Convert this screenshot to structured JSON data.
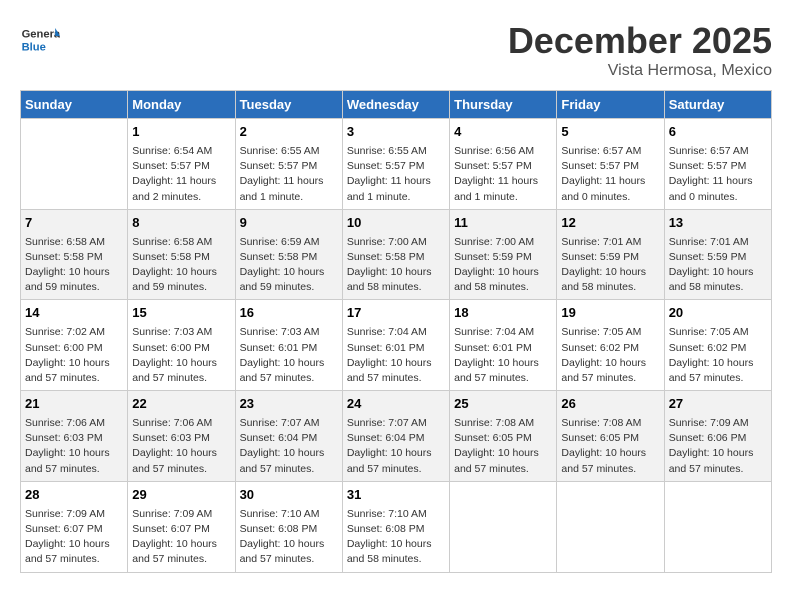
{
  "header": {
    "logo_general": "General",
    "logo_blue": "Blue",
    "title": "December 2025",
    "subtitle": "Vista Hermosa, Mexico"
  },
  "days_of_week": [
    "Sunday",
    "Monday",
    "Tuesday",
    "Wednesday",
    "Thursday",
    "Friday",
    "Saturday"
  ],
  "weeks": [
    [
      {
        "day": "",
        "info": ""
      },
      {
        "day": "1",
        "info": "Sunrise: 6:54 AM\nSunset: 5:57 PM\nDaylight: 11 hours\nand 2 minutes."
      },
      {
        "day": "2",
        "info": "Sunrise: 6:55 AM\nSunset: 5:57 PM\nDaylight: 11 hours\nand 1 minute."
      },
      {
        "day": "3",
        "info": "Sunrise: 6:55 AM\nSunset: 5:57 PM\nDaylight: 11 hours\nand 1 minute."
      },
      {
        "day": "4",
        "info": "Sunrise: 6:56 AM\nSunset: 5:57 PM\nDaylight: 11 hours\nand 1 minute."
      },
      {
        "day": "5",
        "info": "Sunrise: 6:57 AM\nSunset: 5:57 PM\nDaylight: 11 hours\nand 0 minutes."
      },
      {
        "day": "6",
        "info": "Sunrise: 6:57 AM\nSunset: 5:57 PM\nDaylight: 11 hours\nand 0 minutes."
      }
    ],
    [
      {
        "day": "7",
        "info": "Sunrise: 6:58 AM\nSunset: 5:58 PM\nDaylight: 10 hours\nand 59 minutes."
      },
      {
        "day": "8",
        "info": "Sunrise: 6:58 AM\nSunset: 5:58 PM\nDaylight: 10 hours\nand 59 minutes."
      },
      {
        "day": "9",
        "info": "Sunrise: 6:59 AM\nSunset: 5:58 PM\nDaylight: 10 hours\nand 59 minutes."
      },
      {
        "day": "10",
        "info": "Sunrise: 7:00 AM\nSunset: 5:58 PM\nDaylight: 10 hours\nand 58 minutes."
      },
      {
        "day": "11",
        "info": "Sunrise: 7:00 AM\nSunset: 5:59 PM\nDaylight: 10 hours\nand 58 minutes."
      },
      {
        "day": "12",
        "info": "Sunrise: 7:01 AM\nSunset: 5:59 PM\nDaylight: 10 hours\nand 58 minutes."
      },
      {
        "day": "13",
        "info": "Sunrise: 7:01 AM\nSunset: 5:59 PM\nDaylight: 10 hours\nand 58 minutes."
      }
    ],
    [
      {
        "day": "14",
        "info": "Sunrise: 7:02 AM\nSunset: 6:00 PM\nDaylight: 10 hours\nand 57 minutes."
      },
      {
        "day": "15",
        "info": "Sunrise: 7:03 AM\nSunset: 6:00 PM\nDaylight: 10 hours\nand 57 minutes."
      },
      {
        "day": "16",
        "info": "Sunrise: 7:03 AM\nSunset: 6:01 PM\nDaylight: 10 hours\nand 57 minutes."
      },
      {
        "day": "17",
        "info": "Sunrise: 7:04 AM\nSunset: 6:01 PM\nDaylight: 10 hours\nand 57 minutes."
      },
      {
        "day": "18",
        "info": "Sunrise: 7:04 AM\nSunset: 6:01 PM\nDaylight: 10 hours\nand 57 minutes."
      },
      {
        "day": "19",
        "info": "Sunrise: 7:05 AM\nSunset: 6:02 PM\nDaylight: 10 hours\nand 57 minutes."
      },
      {
        "day": "20",
        "info": "Sunrise: 7:05 AM\nSunset: 6:02 PM\nDaylight: 10 hours\nand 57 minutes."
      }
    ],
    [
      {
        "day": "21",
        "info": "Sunrise: 7:06 AM\nSunset: 6:03 PM\nDaylight: 10 hours\nand 57 minutes."
      },
      {
        "day": "22",
        "info": "Sunrise: 7:06 AM\nSunset: 6:03 PM\nDaylight: 10 hours\nand 57 minutes."
      },
      {
        "day": "23",
        "info": "Sunrise: 7:07 AM\nSunset: 6:04 PM\nDaylight: 10 hours\nand 57 minutes."
      },
      {
        "day": "24",
        "info": "Sunrise: 7:07 AM\nSunset: 6:04 PM\nDaylight: 10 hours\nand 57 minutes."
      },
      {
        "day": "25",
        "info": "Sunrise: 7:08 AM\nSunset: 6:05 PM\nDaylight: 10 hours\nand 57 minutes."
      },
      {
        "day": "26",
        "info": "Sunrise: 7:08 AM\nSunset: 6:05 PM\nDaylight: 10 hours\nand 57 minutes."
      },
      {
        "day": "27",
        "info": "Sunrise: 7:09 AM\nSunset: 6:06 PM\nDaylight: 10 hours\nand 57 minutes."
      }
    ],
    [
      {
        "day": "28",
        "info": "Sunrise: 7:09 AM\nSunset: 6:07 PM\nDaylight: 10 hours\nand 57 minutes."
      },
      {
        "day": "29",
        "info": "Sunrise: 7:09 AM\nSunset: 6:07 PM\nDaylight: 10 hours\nand 57 minutes."
      },
      {
        "day": "30",
        "info": "Sunrise: 7:10 AM\nSunset: 6:08 PM\nDaylight: 10 hours\nand 57 minutes."
      },
      {
        "day": "31",
        "info": "Sunrise: 7:10 AM\nSunset: 6:08 PM\nDaylight: 10 hours\nand 58 minutes."
      },
      {
        "day": "",
        "info": ""
      },
      {
        "day": "",
        "info": ""
      },
      {
        "day": "",
        "info": ""
      }
    ]
  ]
}
